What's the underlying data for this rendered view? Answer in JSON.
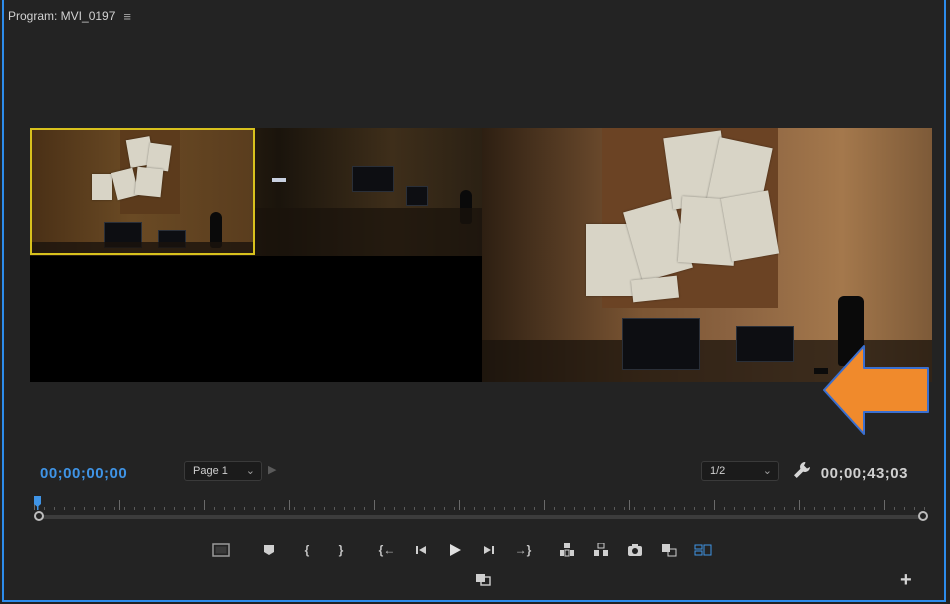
{
  "panel": {
    "title": "Program: MVI_0197",
    "menu_glyph": "≡"
  },
  "viewer": {
    "highlight_color": "#d8c11d",
    "annotation": {
      "shape": "arrow-left",
      "fill": "#f08a2c",
      "stroke": "#3a6fd0"
    }
  },
  "timecode": {
    "current": "00;00;00;00",
    "duration": "00;00;43;03",
    "current_color": "#3f94e6"
  },
  "page_select": {
    "value": "Page 1"
  },
  "resolution_select": {
    "value": "1/2"
  },
  "icons": {
    "page_next": "▶",
    "settings": "wrench-icon"
  },
  "transport": {
    "mark_in_label": "{",
    "mark_out_label": "}",
    "go_to_in_label": "{←",
    "go_to_out_label": "→}"
  },
  "add_button": "+"
}
